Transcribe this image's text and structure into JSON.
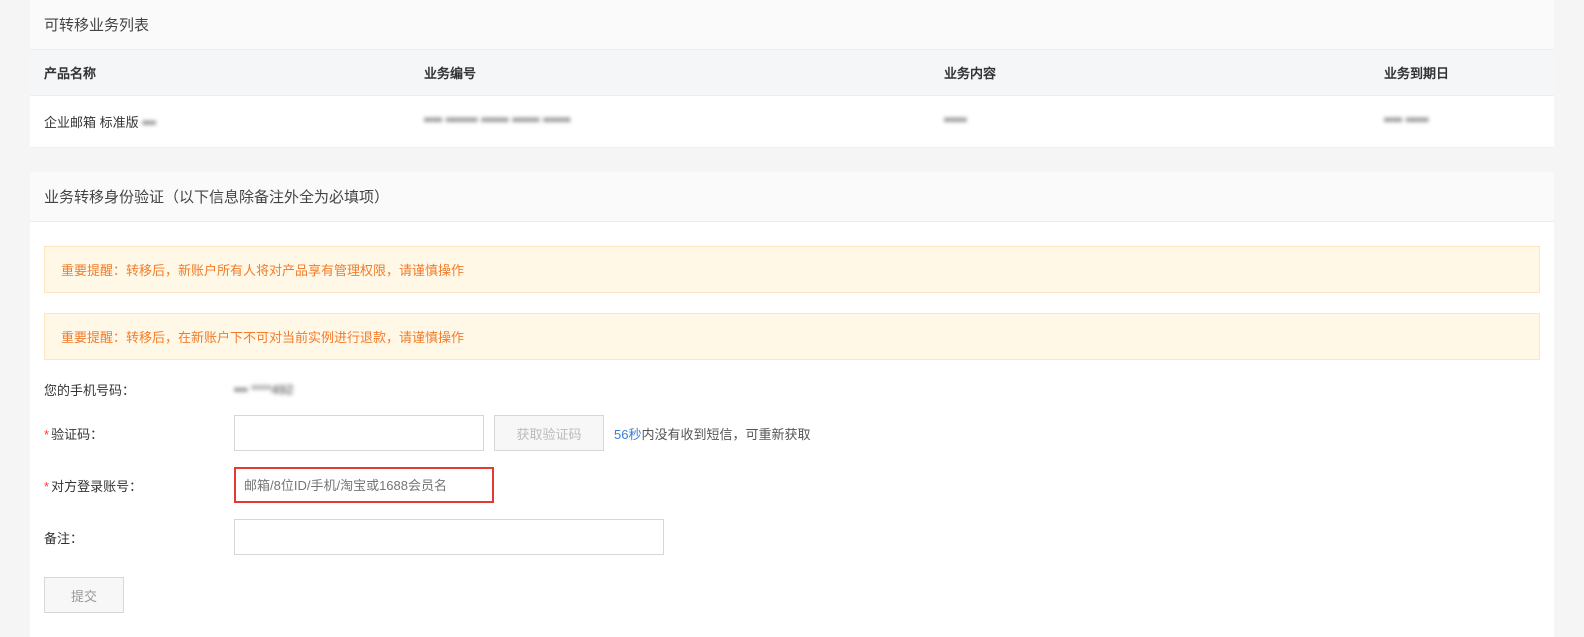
{
  "section_list": {
    "title": "可转移业务列表",
    "columns": {
      "product_name": "产品名称",
      "business_code": "业务编号",
      "business_content": "业务内容",
      "expire_date": "业务到期日"
    },
    "row": {
      "product_name_prefix": "企业邮箱 标准版 ",
      "product_name_masked": "•••",
      "business_code_masked": "•••• ••••••• •••••• •••••• ••••••",
      "business_content_masked": "•••••",
      "expire_date_masked": "•••• •••••"
    }
  },
  "section_verify": {
    "title": "业务转移身份验证（以下信息除备注外全为必填项）",
    "warn1_label": "重要提醒：",
    "warn1_text": "转移后，新账户所有人将对产品享有管理权限，请谨慎操作",
    "warn2_label": "重要提醒：",
    "warn2_text": "转移后，在新账户下不可对当前实例进行退款，请谨慎操作",
    "phone_label": "您的手机号码：",
    "phone_value_masked": "••• ****492",
    "code_label": "验证码：",
    "get_code_btn": "获取验证码",
    "resend_seconds": "56秒",
    "resend_text": "内没有收到短信，可重新获取",
    "target_label": "对方登录账号：",
    "target_placeholder": "邮箱/8位ID/手机/淘宝或1688会员名",
    "remark_label": "备注：",
    "submit_btn": "提交"
  }
}
